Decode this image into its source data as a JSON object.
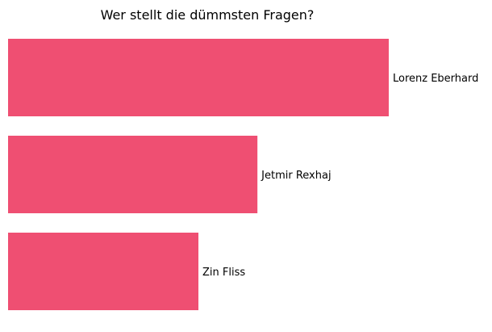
{
  "chart_data": {
    "type": "bar",
    "orientation": "horizontal",
    "title": "Wer stellt die dümmsten Fragen?",
    "categories": [
      "Lorenz Eberhard",
      "Jetmir Rexhaj",
      "Zin Fliss"
    ],
    "values": [
      100,
      65.5,
      50
    ],
    "xlim": [
      0,
      100
    ],
    "bar_color": "#ef4f72",
    "axes_visible": false,
    "grid": false,
    "legend": "none"
  }
}
